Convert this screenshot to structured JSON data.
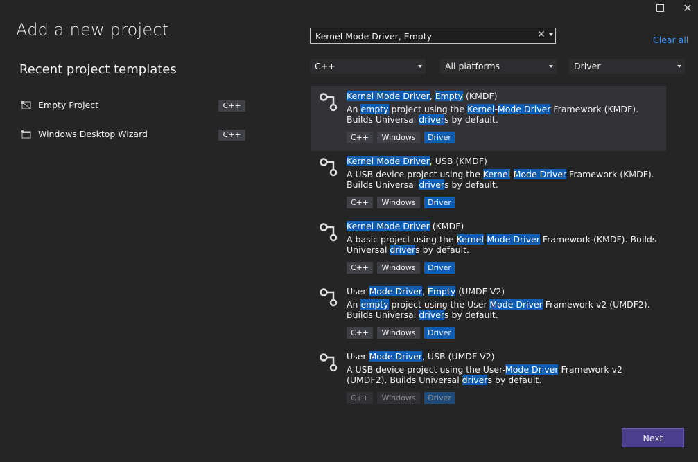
{
  "window": {
    "maximize_glyph": "",
    "close_glyph": "✕"
  },
  "page_title": "Add a new project",
  "search": {
    "value": "Kernel Mode Driver, Empty",
    "clear_glyph": "✕"
  },
  "clear_all": "Clear all",
  "filters": [
    {
      "value": "C++"
    },
    {
      "value": "All platforms"
    },
    {
      "value": "Driver"
    }
  ],
  "recent": {
    "title": "Recent project templates",
    "items": [
      {
        "name": "Empty Project",
        "lang": "C++",
        "icon": "empty-project-icon"
      },
      {
        "name": "Windows Desktop Wizard",
        "lang": "C++",
        "icon": "windows-desktop-wizard-icon"
      }
    ]
  },
  "templates": [
    {
      "title": "Kernel Mode Driver, Empty (KMDF)",
      "description": "An empty project using the Kernel-Mode Driver Framework (KMDF). Builds Universal drivers by default.",
      "tags": [
        "C++",
        "Windows",
        "Driver"
      ]
    },
    {
      "title": "Kernel Mode Driver, USB (KMDF)",
      "description": "A USB device project using the Kernel-Mode Driver Framework (KMDF). Builds Universal drivers by default.",
      "tags": [
        "C++",
        "Windows",
        "Driver"
      ]
    },
    {
      "title": "Kernel Mode Driver (KMDF)",
      "description": "A basic project using the Kernel-Mode Driver Framework (KMDF). Builds Universal drivers by default.",
      "tags": [
        "C++",
        "Windows",
        "Driver"
      ]
    },
    {
      "title": "User Mode Driver, Empty (UMDF V2)",
      "description": "An empty project using the User-Mode Driver Framework v2 (UMDF2). Builds Universal drivers by default.",
      "tags": [
        "C++",
        "Windows",
        "Driver"
      ]
    },
    {
      "title": "User Mode Driver, USB (UMDF V2)",
      "description": "A USB device project using the User-Mode Driver Framework v2 (UMDF2). Builds Universal drivers by default.",
      "tags": [
        "C++",
        "Windows",
        "Driver"
      ]
    }
  ],
  "next_button": "Next",
  "colors": {
    "background": "#252526",
    "highlight": "#0e5db3",
    "accent": "#4b3e8c",
    "link": "#3794ff"
  }
}
